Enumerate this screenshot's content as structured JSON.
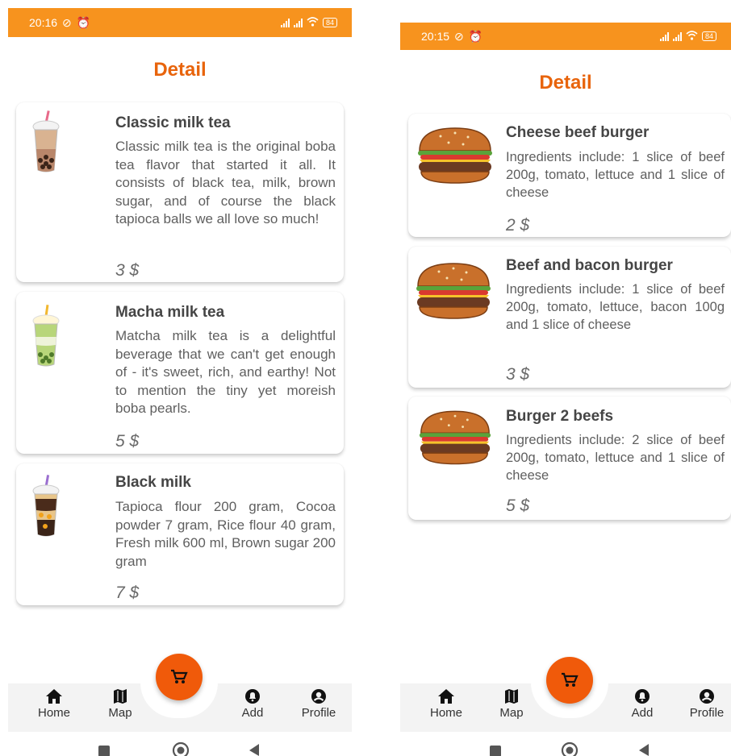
{
  "colors": {
    "accent": "#f7931e",
    "title": "#e8640c",
    "fab": "#f05a0a"
  },
  "screens": [
    {
      "status": {
        "time": "20:16",
        "battery": "84"
      },
      "title": "Detail",
      "items": [
        {
          "name": "Classic milk tea",
          "description": "Classic milk tea is the original boba tea flavor that started it all.  It consists of black tea, milk, brown sugar, and of course the black tapioca balls we all love so much!",
          "price": "3 $",
          "image": "classic-milk-tea-image"
        },
        {
          "name": "Macha milk tea",
          "description": "Matcha milk tea is a delightful beverage that we can't get enough of - it's sweet, rich, and earthy! Not to mention the tiny yet moreish boba pearls.",
          "price": "5 $",
          "image": "matcha-milk-tea-image"
        },
        {
          "name": "Black milk",
          "description": "Tapioca flour 200 gram, Cocoa powder 7 gram, Rice flour 40 gram, Fresh milk 600 ml, Brown sugar 200 gram",
          "price": "7 $",
          "image": "black-milk-image"
        }
      ],
      "nav": [
        {
          "label": "Home",
          "icon": "home-icon"
        },
        {
          "label": "Map",
          "icon": "map-icon"
        },
        {
          "label": "Add",
          "icon": "bell-icon"
        },
        {
          "label": "Profile",
          "icon": "profile-icon"
        }
      ]
    },
    {
      "status": {
        "time": "20:15",
        "battery": "84"
      },
      "title": "Detail",
      "items": [
        {
          "name": "Cheese beef burger",
          "description": "Ingredients include: 1 slice of beef 200g, tomato, lettuce and 1 slice of cheese",
          "price": "2 $",
          "image": "cheese-burger-image"
        },
        {
          "name": "Beef and bacon burger",
          "description": "Ingredients include: 1 slice of beef 200g, tomato, lettuce, bacon 100g and 1 slice of cheese",
          "price": "3 $",
          "image": "bacon-burger-image"
        },
        {
          "name": "Burger 2 beefs",
          "description": "Ingredients include: 2 slice of beef 200g, tomato, lettuce and 1 slice of cheese",
          "price": "5 $",
          "image": "double-burger-image"
        }
      ],
      "nav": [
        {
          "label": "Home",
          "icon": "home-icon"
        },
        {
          "label": "Map",
          "icon": "map-icon"
        },
        {
          "label": "Add",
          "icon": "bell-icon"
        },
        {
          "label": "Profile",
          "icon": "profile-icon"
        }
      ]
    }
  ]
}
